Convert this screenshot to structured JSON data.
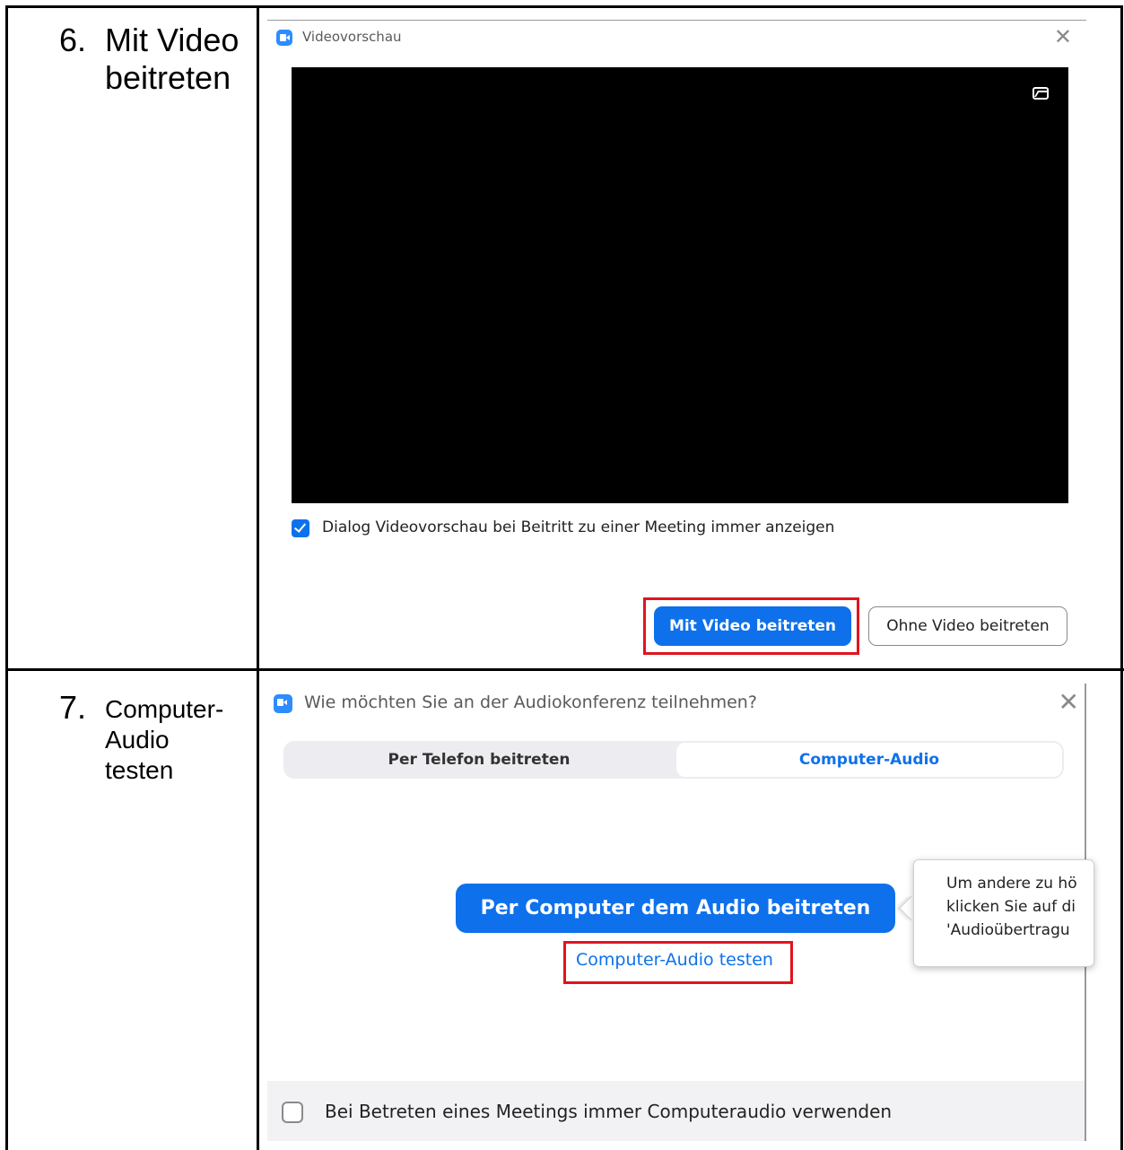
{
  "steps": [
    {
      "number": "6.",
      "label": "Mit Video\nbeitreten"
    },
    {
      "number": "7.",
      "label": "Computer-\nAudio\ntesten"
    }
  ],
  "video_dialog": {
    "title": "Videovorschau",
    "checkbox_label": "Dialog Videovorschau bei Beitritt zu einer Meeting immer anzeigen",
    "checkbox_checked": true,
    "join_with_video": "Mit Video beitreten",
    "join_without_video": "Ohne Video beitreten"
  },
  "audio_dialog": {
    "title": "Wie möchten Sie an der Audiokonferenz teilnehmen?",
    "tabs": [
      "Per Telefon beitreten",
      "Computer-Audio"
    ],
    "active_tab": "Computer-Audio",
    "join_audio_button": "Per Computer dem Audio beitreten",
    "test_audio_link": "Computer-Audio testen",
    "tooltip_lines": [
      "Um andere zu hö",
      "klicken Sie auf di",
      "'Audioübertragu"
    ],
    "footer_checkbox_label": "Bei Betreten eines Meetings immer Computeraudio verwenden",
    "footer_checkbox_checked": false
  },
  "colors": {
    "accent": "#0E71EB",
    "highlight": "#E0141E",
    "zoom_icon": "#2D8CFF"
  },
  "icons": [
    "zoom-logo-icon",
    "close-icon",
    "background-image-icon",
    "checkbox-checked-icon",
    "checkbox-empty-icon"
  ]
}
